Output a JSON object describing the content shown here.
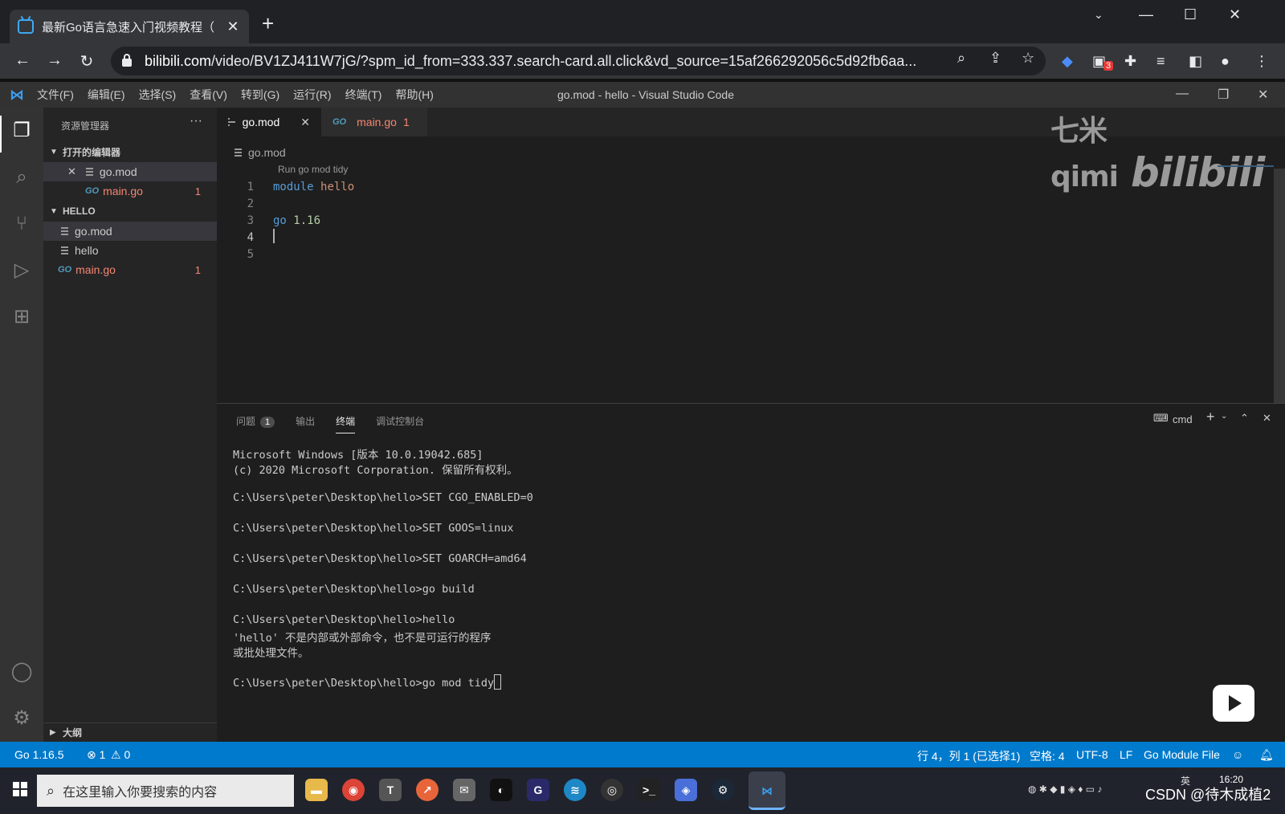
{
  "browser": {
    "tab_title": "最新Go语言急速入门视频教程（",
    "tab_close": "✕",
    "new_tab": "+",
    "url_host": "bilibili.com",
    "url_path": "/video/BV1ZJ411W7jG/?spm_id_from=333.337.search-card.all.click&vd_source=15af266292056c5d92fb6aa...",
    "extension_badge": "3"
  },
  "vscode": {
    "menu": [
      "文件(F)",
      "编辑(E)",
      "选择(S)",
      "查看(V)",
      "转到(G)",
      "运行(R)",
      "终端(T)",
      "帮助(H)"
    ],
    "window_title": "go.mod - hello - Visual Studio Code",
    "sidebar": {
      "title": "资源管理器",
      "more": "···",
      "open_editors_label": "打开的编辑器",
      "open_editors": [
        {
          "name": "go.mod",
          "close": "✕"
        },
        {
          "name": "main.go",
          "problems": "1",
          "go_icon": "GO"
        }
      ],
      "folder_label": "HELLO",
      "files": [
        {
          "name": "go.mod"
        },
        {
          "name": "hello"
        },
        {
          "name": "main.go",
          "problems": "1",
          "go_icon": "GO"
        }
      ],
      "outline_label": "大纲"
    },
    "tabs": [
      {
        "label": "go.mod",
        "close": "✕"
      },
      {
        "label": "main.go",
        "problems": "1",
        "go_icon": "GO"
      }
    ],
    "watermark": {
      "text": "七米qimi",
      "logo": "bilibili"
    },
    "breadcrumb": "go.mod",
    "codelens": "Run go mod tidy",
    "code": {
      "line_numbers": [
        "1",
        "2",
        "3",
        "4",
        "5"
      ],
      "line1_kw": "module",
      "line1_id": "hello",
      "line3_kw": "go",
      "line3_num": "1.16"
    },
    "panel": {
      "tabs": [
        "问题",
        "输出",
        "终端",
        "调试控制台"
      ],
      "problems_badge": "1",
      "shell": "cmd",
      "terminal_lines": [
        "Microsoft Windows [版本 10.0.19042.685]",
        "(c) 2020 Microsoft Corporation. 保留所有权利。",
        "",
        "C:\\Users\\peter\\Desktop\\hello>SET CGO_ENABLED=0",
        "",
        "C:\\Users\\peter\\Desktop\\hello>SET GOOS=linux",
        "",
        "C:\\Users\\peter\\Desktop\\hello>SET GOARCH=amd64",
        "",
        "C:\\Users\\peter\\Desktop\\hello>go build",
        "",
        "C:\\Users\\peter\\Desktop\\hello>hello",
        "'hello' 不是内部或外部命令，也不是可运行的程序",
        "或批处理文件。",
        ""
      ],
      "current_command": "C:\\Users\\peter\\Desktop\\hello>go mod tidy"
    },
    "statusbar": {
      "go_version": "Go 1.16.5",
      "errors": "⊗ 1",
      "warnings": "⚠ 0",
      "position": "行 4，列 1 (已选择1)",
      "spaces": "空格: 4",
      "encoding": "UTF-8",
      "eol": "LF",
      "language": "Go Module File"
    }
  },
  "taskbar": {
    "search_placeholder": "在这里输入你要搜索的内容",
    "clock": "16:20",
    "ime": "英",
    "csdn_watermark": "CSDN @待木成植2"
  },
  "colors": {
    "statusbar": "#007acc",
    "editor_bg": "#1e1e1e",
    "error": "#f48771",
    "keyword": "#569cd6"
  }
}
